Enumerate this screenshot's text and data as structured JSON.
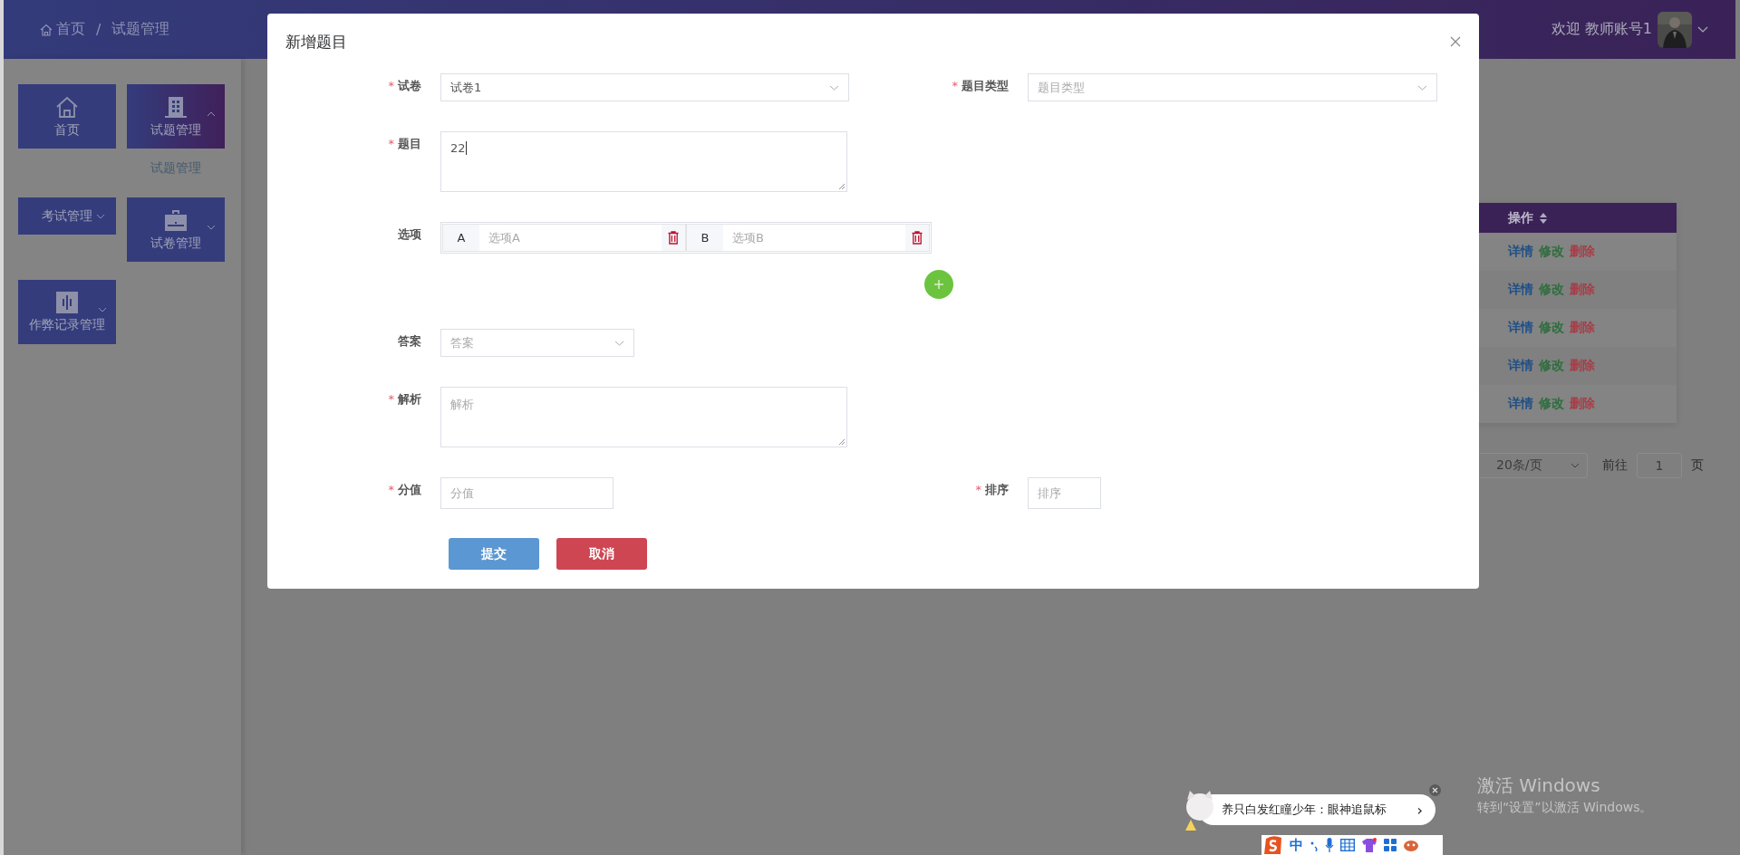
{
  "header": {
    "breadcrumb": [
      "首页",
      "试题管理"
    ],
    "separator": "/",
    "welcome": "欢迎 教师账号1"
  },
  "sidebar": {
    "items": [
      {
        "label": "首页",
        "kind": "link",
        "selected": false
      },
      {
        "label": "试题管理",
        "kind": "menu",
        "selected": true,
        "expanded": true,
        "children": [
          {
            "label": "试题管理"
          }
        ]
      },
      {
        "label": "考试管理",
        "kind": "menu",
        "selected": false,
        "expanded": false
      },
      {
        "label": "试卷管理",
        "kind": "menu",
        "selected": false,
        "expanded": false
      },
      {
        "label": "作弊记录管理",
        "kind": "menu",
        "selected": false,
        "expanded": false
      }
    ]
  },
  "table": {
    "columns": [
      "操作"
    ],
    "rows": [
      {
        "actions": [
          "详情",
          "修改",
          "删除"
        ]
      },
      {
        "actions": [
          "详情",
          "修改",
          "删除"
        ]
      },
      {
        "actions": [
          "详情",
          "修改",
          "删除"
        ]
      },
      {
        "actions": [
          "详情",
          "修改",
          "删除"
        ]
      },
      {
        "actions": [
          "详情",
          "修改",
          "删除"
        ]
      }
    ]
  },
  "pagination": {
    "page_size": "20条/页",
    "goto_label": "前往",
    "page": "1",
    "page_suffix": "页"
  },
  "dialog": {
    "title": "新增题目",
    "required_mark": "*",
    "rows": [
      [
        {
          "label": "试卷",
          "required": true,
          "kind": "select",
          "value": "试卷1"
        },
        {
          "label": "题目类型",
          "required": true,
          "kind": "select",
          "placeholder": "题目类型"
        }
      ],
      [
        {
          "label": "题目",
          "required": true,
          "kind": "textarea",
          "value": "22"
        }
      ],
      [
        {
          "label": "选项",
          "required": false,
          "kind": "options",
          "options": [
            {
              "letter": "A",
              "placeholder": "选项A"
            },
            {
              "letter": "B",
              "placeholder": "选项B"
            }
          ]
        }
      ],
      [
        {
          "label": "答案",
          "required": false,
          "kind": "select",
          "placeholder": "答案"
        }
      ],
      [
        {
          "label": "解析",
          "required": true,
          "kind": "textarea",
          "placeholder": "解析"
        }
      ],
      [
        {
          "label": "分值",
          "required": true,
          "kind": "input",
          "placeholder": "分值"
        },
        {
          "label": "排序",
          "required": true,
          "kind": "input",
          "placeholder": "排序"
        }
      ]
    ],
    "buttons": [
      {
        "label": "提交",
        "kind": "primary"
      },
      {
        "label": "取消",
        "kind": "danger"
      }
    ]
  },
  "notification": {
    "text": "养只白发红瞳少年：眼神追鼠标",
    "arrow": "›"
  },
  "ime_toolbar": {
    "label": "中"
  },
  "activation": {
    "title": "激活 Windows",
    "text": "转到“设置”以激活 Windows。"
  }
}
